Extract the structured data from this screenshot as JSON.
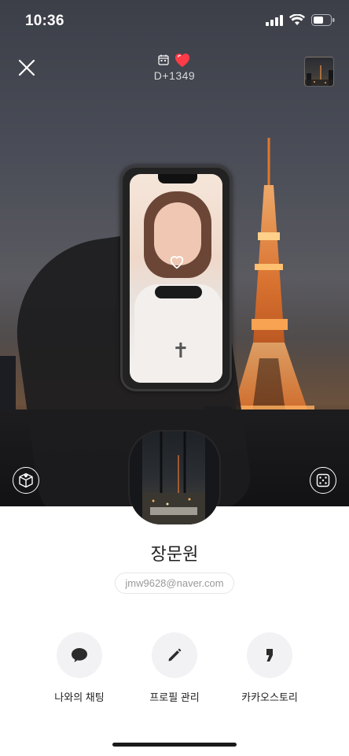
{
  "status_bar": {
    "time": "10:36",
    "icons": [
      "signal-icon",
      "wifi-icon",
      "battery-icon"
    ]
  },
  "top_bar": {
    "close_icon": "close-icon",
    "dday_calendar_icon": "calendar-icon",
    "dday_heart_icon": "heart-icon",
    "dday_text": "D+1349",
    "thumbnail": "background-thumbnail"
  },
  "profile": {
    "name": "장문원",
    "email": "jmw9628@naver.com"
  },
  "actions": [
    {
      "label": "나와의 채팅",
      "icon": "chat-bubble-icon"
    },
    {
      "label": "프로필 관리",
      "icon": "pencil-icon"
    },
    {
      "label": "카카오스토리",
      "icon": "quote-icon"
    }
  ],
  "colors": {
    "heart": "#ff3b47",
    "action_bg": "#f2f2f4",
    "name_text": "#1e1e1e",
    "email_text": "#9a9a9a"
  }
}
